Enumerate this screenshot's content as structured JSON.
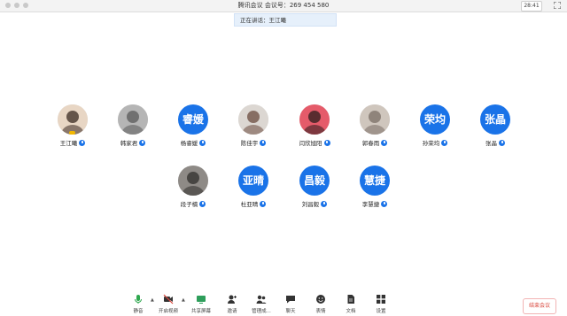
{
  "window": {
    "title": "腾讯会议  会议号：269 454 580",
    "clock": "28:41"
  },
  "speaking": {
    "label": "正在讲话：王江曦"
  },
  "participants": [
    {
      "name": "王江曦",
      "avatar": "photo",
      "initials": "",
      "host": true
    },
    {
      "name": "韩家君",
      "avatar": "photo",
      "initials": ""
    },
    {
      "name": "杨睿媛",
      "avatar": "initials",
      "initials": "睿媛"
    },
    {
      "name": "陈佳宇",
      "avatar": "photo",
      "initials": ""
    },
    {
      "name": "闫欣旭阳",
      "avatar": "photo",
      "initials": ""
    },
    {
      "name": "郭春雨",
      "avatar": "photo",
      "initials": ""
    },
    {
      "name": "孙荣均",
      "avatar": "initials",
      "initials": "荣均"
    },
    {
      "name": "张晶",
      "avatar": "initials",
      "initials": "张晶"
    },
    {
      "name": "段子楠",
      "avatar": "photo",
      "initials": ""
    },
    {
      "name": "杜亚晴",
      "avatar": "initials",
      "initials": "亚晴"
    },
    {
      "name": "刘昌毅",
      "avatar": "initials",
      "initials": "昌毅"
    },
    {
      "name": "李慧捷",
      "avatar": "initials",
      "initials": "慧捷"
    }
  ],
  "toolbar": {
    "mute": "静音",
    "video": "开启视频",
    "share": "共享屏幕",
    "invite": "邀请",
    "manage": "管理成...",
    "chat": "聊天",
    "emoji": "表情",
    "docs": "文档",
    "settings": "设置",
    "leave": "结束会议"
  },
  "colors": {
    "accent": "#1a73e8",
    "leave": "#d9463c",
    "speaking_bg": "#e6f0fb"
  }
}
